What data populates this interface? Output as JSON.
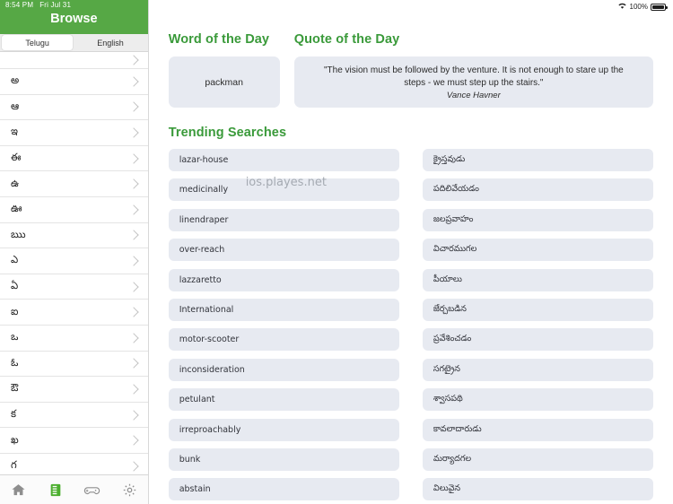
{
  "status_bar": {
    "time": "8:54 PM",
    "date": "Fri Jul 31",
    "wifi_icon": "wifi-icon",
    "battery_percent": "100%",
    "battery_icon": "battery-full-icon"
  },
  "sidebar": {
    "title": "Browse",
    "segmented": {
      "options": [
        "Telugu",
        "English"
      ],
      "selected": "Telugu"
    },
    "letters": [
      {
        "label": ""
      },
      {
        "label": "అ"
      },
      {
        "label": "ఆ"
      },
      {
        "label": "ఇ"
      },
      {
        "label": "ఈ"
      },
      {
        "label": "ఉ"
      },
      {
        "label": "ఊ"
      },
      {
        "label": "ఋ"
      },
      {
        "label": "ఎ"
      },
      {
        "label": "ఏ"
      },
      {
        "label": "ఐ"
      },
      {
        "label": "ఒ"
      },
      {
        "label": "ఓ"
      },
      {
        "label": "ఔ"
      },
      {
        "label": "క"
      },
      {
        "label": "ఖ"
      },
      {
        "label": "గ"
      }
    ],
    "tabs": [
      {
        "name": "home-icon",
        "label": "Home",
        "active": false
      },
      {
        "name": "book-icon",
        "label": "Browse",
        "active": true
      },
      {
        "name": "gamepad-icon",
        "label": "Games",
        "active": false
      },
      {
        "name": "gear-icon",
        "label": "Settings",
        "active": false
      }
    ]
  },
  "main": {
    "word_of_the_day": {
      "title": "Word of the Day",
      "word": "packman"
    },
    "quote_of_the_day": {
      "title": "Quote of the Day",
      "text": "\"The vision must be followed by the venture. It is not enough to stare up the steps - we must step up the stairs.\"",
      "author": "Vance Havner"
    },
    "trending": {
      "title": "Trending Searches",
      "left_column": [
        "lazar-house",
        "medicinally",
        "linendraper",
        "over-reach",
        "lazzaretto",
        "International",
        "motor-scooter",
        "inconsideration",
        "petulant",
        "irreproachably",
        "bunk",
        "abstain"
      ],
      "right_column": [
        "క్రైస్తవుడు",
        "పదిలివేయడం",
        "జలప్రవాహం",
        "విచారముగల",
        "పీయాలు",
        "జేర్చబడిన",
        "ప్రవేశించడం",
        "సగట్రైన",
        "శ్వాసపథి",
        "కావలాదారుడు",
        "మర్యాదగల",
        "విలువైన"
      ]
    },
    "watermark": "ios.playes.net"
  },
  "colors": {
    "brand_green": "#56a845",
    "heading_green": "#3a9a3a",
    "pill_background": "#e7eaf1"
  }
}
